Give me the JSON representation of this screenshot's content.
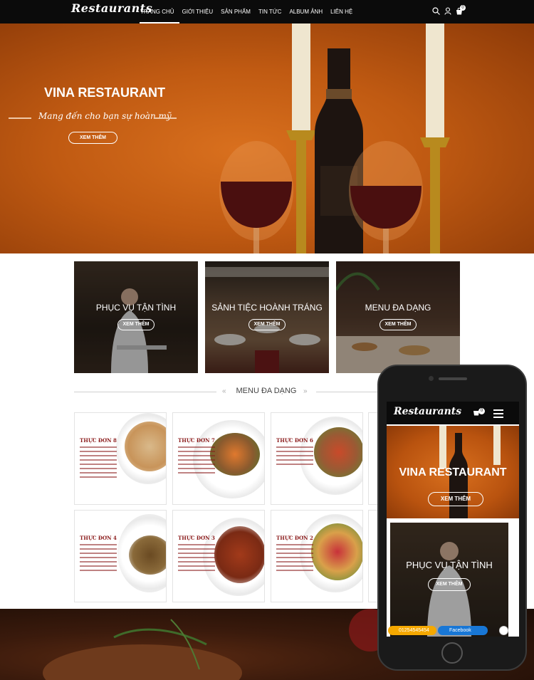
{
  "header": {
    "logo": "Restaurants",
    "nav": [
      "TRANG CHỦ",
      "GIỚI THIỆU",
      "SẢN PHẨM",
      "TIN TỨC",
      "ALBUM ẢNH",
      "LIÊN HỆ"
    ],
    "active_index": 0,
    "cart_count": "0",
    "icons": [
      "search-icon",
      "user-icon",
      "cart-icon"
    ]
  },
  "hero": {
    "title": "VINA RESTAURANT",
    "slogan": "Mang đến cho bạn sự hoàn mỹ",
    "button": "XEM THÊM"
  },
  "features": [
    {
      "title": "PHỤC VỤ TẬN TÌNH",
      "button": "XEM THÊM"
    },
    {
      "title": "SẢNH TIỆC HOÀNH TRÁNG",
      "button": "XEM THÊM"
    },
    {
      "title": "MENU ĐA DẠNG",
      "button": "XEM THÊM"
    }
  ],
  "menu_section": {
    "title": "MENU ĐA DẠNG",
    "cards": [
      {
        "title": "THỰC ĐƠN 8"
      },
      {
        "title": "THỰC ĐƠN 7"
      },
      {
        "title": "THỰC ĐƠN 6"
      },
      {
        "title": "THỰC ĐƠN 4"
      },
      {
        "title": "THỰC ĐƠN 3"
      },
      {
        "title": "THỰC ĐƠN 2"
      }
    ]
  },
  "mobile": {
    "logo": "Restaurants",
    "cart_count": "0",
    "hero_title": "VINA RESTAURANT",
    "hero_button": "XEM THÊM",
    "card_title": "PHỤC VỤ TẬN TÌNH",
    "card_button": "XEM THÊM",
    "phone_number": "01254545454",
    "facebook_label": "Facebook"
  },
  "colors": {
    "hero_orange": "#c05a12",
    "header_black": "#0b0b0b",
    "menu_title_red": "#8b1b1b",
    "phone_badge": "#f5a800",
    "facebook_blue": "#1877d6"
  }
}
